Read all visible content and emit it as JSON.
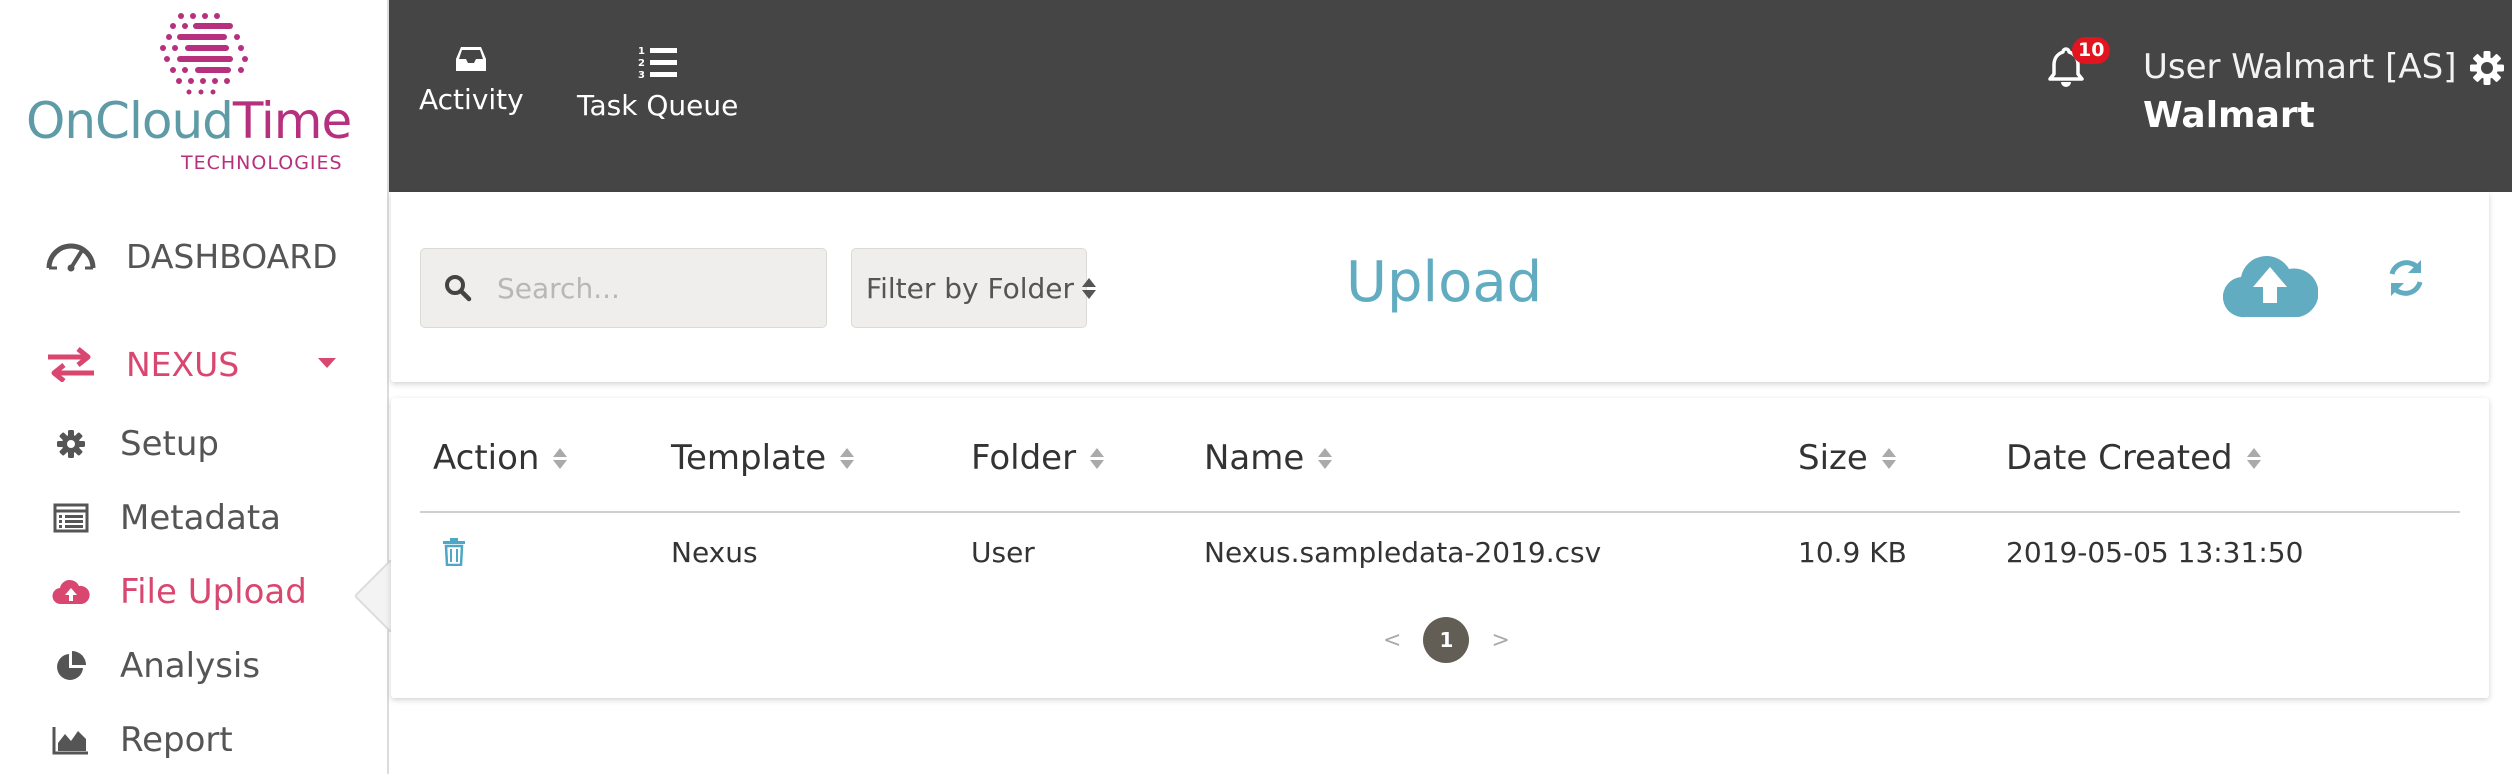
{
  "brand": {
    "name_part1": "OnCloud",
    "name_part2": "Time",
    "subtitle": "TECHNOLOGIES",
    "colors": {
      "teal": "#5f9ba6",
      "magenta": "#b6307e"
    }
  },
  "sidebar": {
    "dashboard": {
      "label": "DASHBOARD",
      "icon": "gauge-icon"
    },
    "nexus": {
      "label": "NEXUS",
      "icon": "exchange-arrows-icon",
      "accent": "#d94771"
    },
    "items": [
      {
        "label": "Setup",
        "icon": "gear-icon"
      },
      {
        "label": "Metadata",
        "icon": "list-box-icon"
      },
      {
        "label": "File Upload",
        "icon": "cloud-upload-icon",
        "active": true
      },
      {
        "label": "Analysis",
        "icon": "pie-chart-icon"
      },
      {
        "label": "Report",
        "icon": "area-chart-icon"
      }
    ]
  },
  "topbar": {
    "activity_label": "Activity",
    "task_queue_label": "Task Queue",
    "notification_count": "10",
    "user_name": "User Walmart [AS]",
    "company": "Walmart"
  },
  "upload_panel": {
    "search_placeholder": "Search...",
    "folder_filter_label": "Filter by Folder",
    "title": "Upload",
    "title_color": "#62acc1"
  },
  "table": {
    "headers": [
      "Action",
      "Template",
      "Folder",
      "Name",
      "Size",
      "Date Created"
    ],
    "rows": [
      {
        "template": "Nexus",
        "folder": "User",
        "name": "Nexus.sampledata-2019.csv",
        "size": "10.9 KB",
        "date_created": "2019-05-05 13:31:50"
      }
    ]
  },
  "pagination": {
    "prev": "<",
    "current": "1",
    "next": ">"
  }
}
